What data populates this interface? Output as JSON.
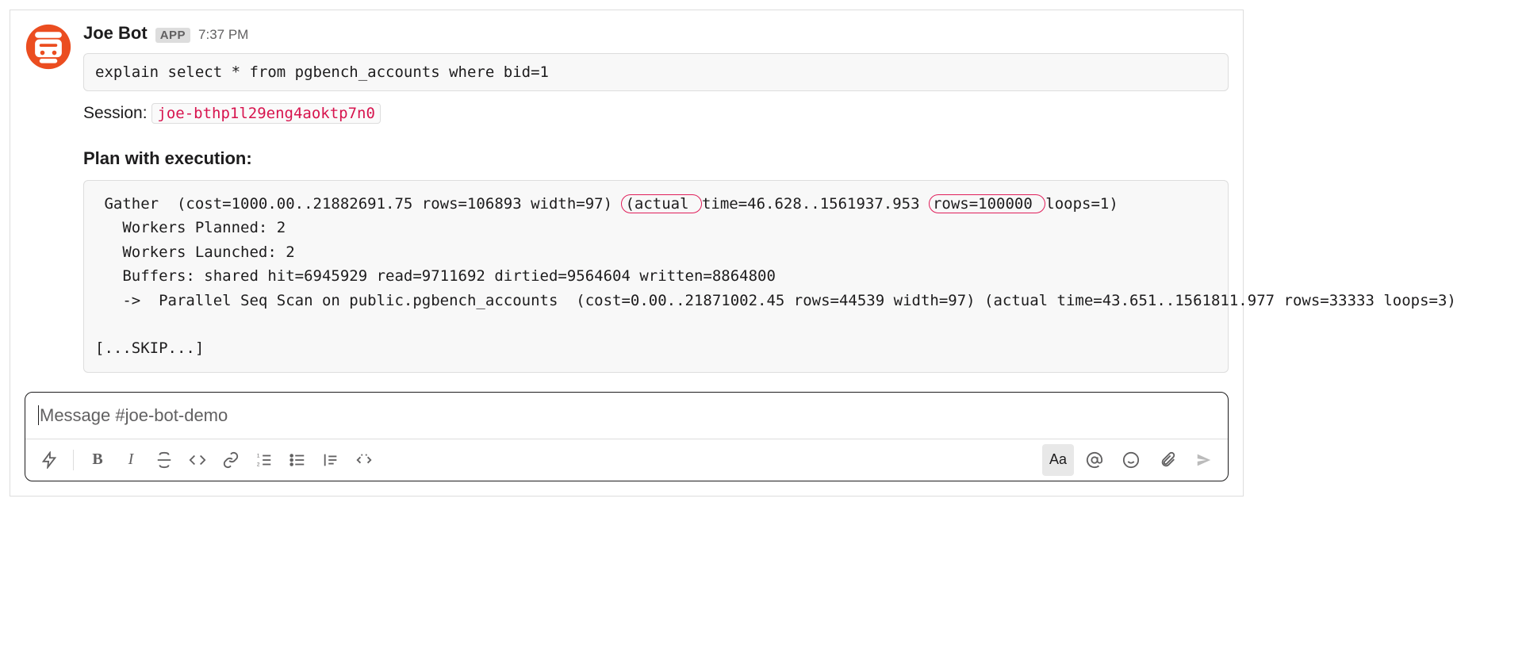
{
  "message": {
    "sender": "Joe Bot",
    "badge": "APP",
    "timestamp": "7:37 PM",
    "command": "explain select * from pgbench_accounts where bid=1",
    "session_label": "Session:",
    "session_id": "joe-bthp1l29eng4aoktp7n0",
    "plan_title": "Plan with execution:",
    "plan": {
      "l1a": " Gather  (cost=1000.00..21882691.75 rows=106893 width=97) ",
      "l1_hl1": "(actual ",
      "l1b": "time=46.628..1561937.953 ",
      "l1_hl2": "rows=100000 ",
      "l1c": "loops=1)",
      "l2": "   Workers Planned: 2",
      "l3": "   Workers Launched: 2",
      "l4": "   Buffers: shared hit=6945929 read=9711692 dirtied=9564604 written=8864800",
      "l5": "   ->  Parallel Seq Scan on public.pgbench_accounts  (cost=0.00..21871002.45 rows=44539 width=97) (actual time=43.651..1561811.977 rows=33333 loops=3)",
      "l6": "",
      "l7": "[...SKIP...]"
    }
  },
  "composer": {
    "placeholder": "Message #joe-bot-demo",
    "format_label": "Aa"
  }
}
